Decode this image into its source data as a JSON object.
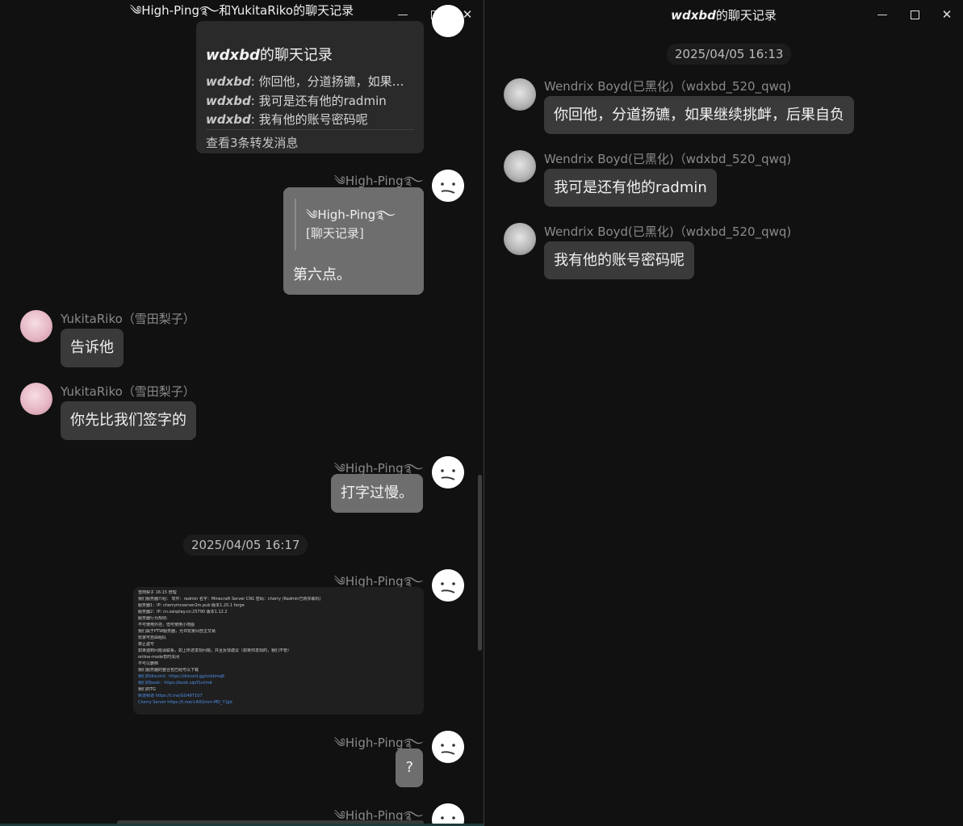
{
  "left_window": {
    "title_prefix": "༄High-Ping࿐",
    "title_mid": "和",
    "title_suffix": "YukitaRiko的聊天记录",
    "forward_card": {
      "title_name": "wdxbd",
      "title_suffix": "的聊天记录",
      "lines": [
        {
          "sender": "wdxbd",
          "text": ": 你回他，分道扬镳，如果继..."
        },
        {
          "sender": "wdxbd",
          "text": ": 我可是还有他的radmin"
        },
        {
          "sender": "wdxbd",
          "text": ": 我有他的账号密码呢"
        }
      ],
      "footer": "查看3条转发消息"
    },
    "me_name": "༄High-Ping࿐",
    "quote": {
      "name": "༄High-Ping࿐",
      "text": "[聊天记录]",
      "message": "第六点。"
    },
    "riko_name": "YukitaRiko（雪田梨子）",
    "msg_riko_1": "告诉他",
    "msg_riko_2": "你先比我们签字的",
    "msg_me_1": "打字过慢。",
    "timestamp": "2025/04/05 16:17",
    "screenshot_lines": [
      "雪田梨子 16:15 管理",
      "我们服务器介绍： 软件：radmin 名字：Minecraft Server CN1 密码：cherry (Radmin已购买联机)",
      "服务器1：IP: cherrymcserver2m.pub 版本1.20.1 forge",
      "服务器2：IP: cn.saisplay.cn:25790 版本1.12.2",
      "服务器行为规则:",
      "不可使用外挂，但可使用小地图",
      "我们属于PTW服务器，允许玩家间自主交易",
      "玩家可自由组队",
      "禁止盗号",
      "如果遇到问题请联系，如上所述发现问题，并且反馈建议（如果你发现的，我们不管）",
      "online-mode暂时关闭",
      "不可以删档",
      "我们服务器的整合包已经可以下载",
      "我们的discord：https://discord.gg/xcbbmq6",
      "我们的book：https://book.sip/f1xi/mb",
      "我们的TG",
      "频道频道 https://t.me/GG497107",
      "Cherry Server https://t.me/+AXGmm-MD_Y1jjd"
    ],
    "msg_me_2": "?"
  },
  "right_window": {
    "title_name": "wdxbd",
    "title_suffix": "的聊天记录",
    "timestamp": "2025/04/05 16:13",
    "sender_name": "Wendrix Boyd(已黑化)（wdxbd_520_qwq)",
    "messages": [
      "你回他，分道扬镳，如果继续挑衅，后果自负",
      "我可是还有他的radmin",
      "我有他的账号密码呢"
    ]
  },
  "window_controls": {
    "minimize": "—",
    "maximize": "☐",
    "close": "✕"
  }
}
